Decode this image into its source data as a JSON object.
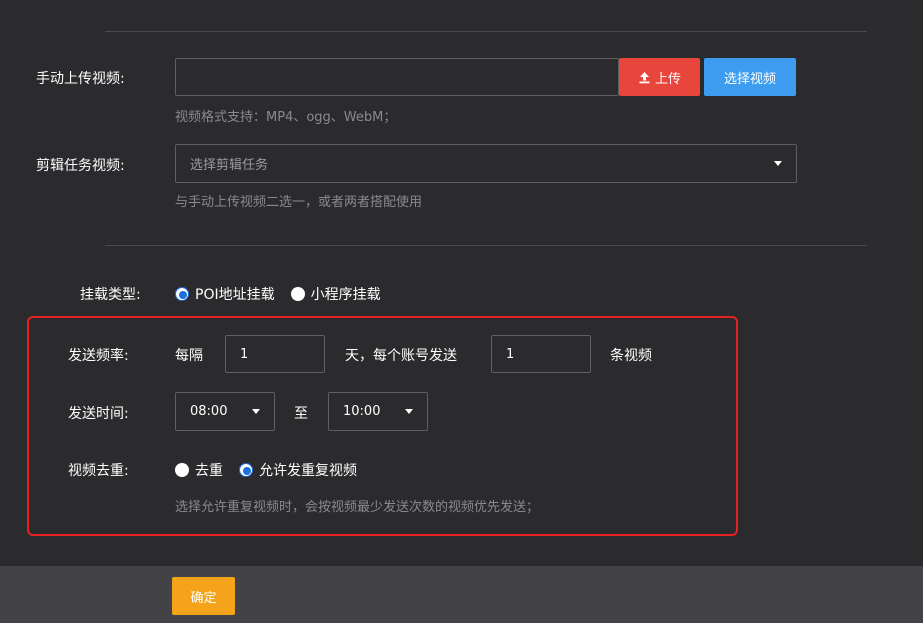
{
  "manual_upload": {
    "label": "手动上传视频:",
    "upload_button": "上传",
    "choose_button": "选择视频",
    "hint": "视频格式支持：MP4、ogg、WebM；"
  },
  "edit_task": {
    "label": "剪辑任务视频:",
    "placeholder": "选择剪辑任务",
    "hint": "与手动上传视频二选一，或者两者搭配使用"
  },
  "mount": {
    "label": "挂载类型:",
    "options": [
      "POI地址挂载",
      "小程序挂载"
    ],
    "selected": "POI地址挂载"
  },
  "frequency": {
    "label": "发送频率:",
    "prefix": "每隔",
    "days_value": "1",
    "middle": "天，每个账号发送",
    "count_value": "1",
    "suffix": "条视频"
  },
  "send_time": {
    "label": "发送时间:",
    "start": "08:00",
    "separator": "至",
    "end": "10:00"
  },
  "dedupe": {
    "label": "视频去重:",
    "options": [
      "去重",
      "允许发重复视频"
    ],
    "selected": "允许发重复视频",
    "hint": "选择允许重复视频时，会按视频最少发送次数的视频优先发送；"
  },
  "footer": {
    "confirm": "确定"
  },
  "colors": {
    "background": "#2b2b2e",
    "upload": "#e8453c",
    "choose": "#3d9cef",
    "confirm": "#f5a31a",
    "highlight": "#e52222",
    "radio_checked": "#1e6fe0"
  }
}
